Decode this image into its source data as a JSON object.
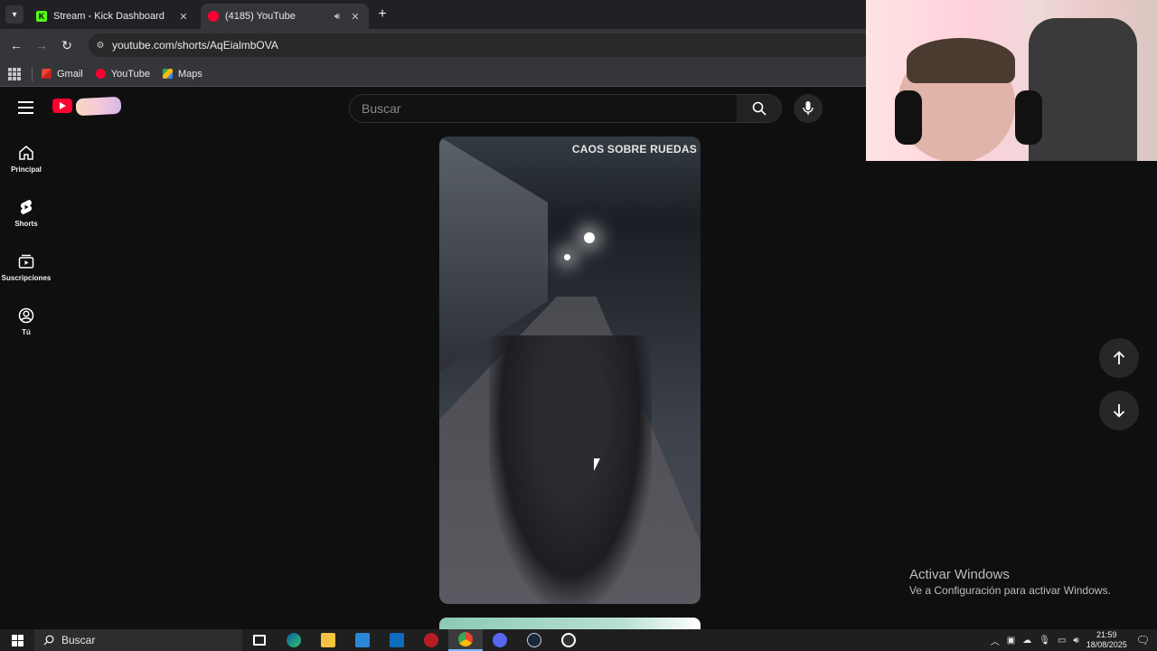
{
  "browser": {
    "tabs": [
      {
        "title": "Stream - Kick Dashboard"
      },
      {
        "title": "(4185) YouTube"
      }
    ],
    "url": "youtube.com/shorts/AqEialmbOVA",
    "bookmarks": [
      {
        "label": "Gmail"
      },
      {
        "label": "YouTube"
      },
      {
        "label": "Maps"
      }
    ]
  },
  "youtube": {
    "search_placeholder": "Buscar",
    "guide": [
      {
        "label": "Principal"
      },
      {
        "label": "Shorts"
      },
      {
        "label": "Suscripciones"
      },
      {
        "label": "Tú"
      }
    ],
    "short": {
      "watermark": "CAOS SOBRE RUEDAS"
    }
  },
  "windows": {
    "activate_title": "Activar Windows",
    "activate_subtitle": "Ve a Configuración para activar Windows.",
    "taskbar_search": "Buscar",
    "time": "21:59",
    "date": "18/08/2025"
  },
  "colors": {
    "youtube_red": "#ff0033",
    "kick_green": "#53fc18",
    "chrome_dark": "#202124"
  }
}
